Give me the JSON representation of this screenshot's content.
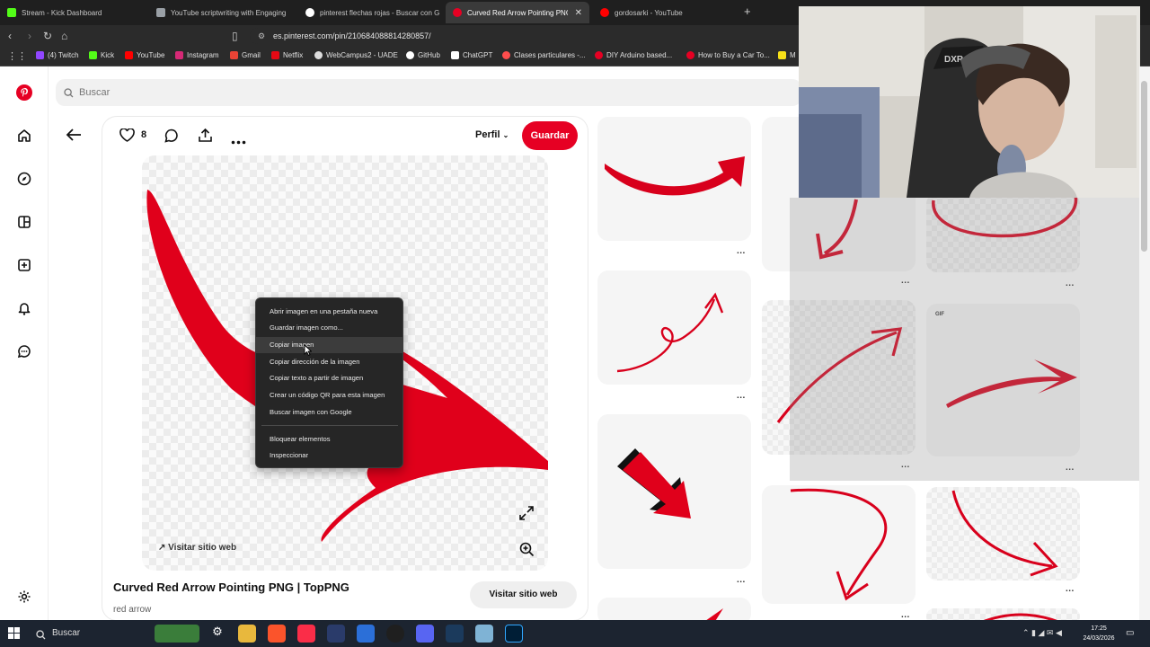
{
  "browser": {
    "tabs": [
      {
        "title": "Stream - Kick Dashboard",
        "color": "#53fc18"
      },
      {
        "title": "YouTube scriptwriting with Engaging",
        "color": "#9aa0a6"
      },
      {
        "title": "pinterest flechas rojas - Buscar con G",
        "color": "#ffffff"
      },
      {
        "title": "Curved Red Arrow Pointing PNG",
        "color": "#e60023"
      },
      {
        "title": "gordosarki - YouTube",
        "color": "#ff0000"
      }
    ],
    "new_tab": "+",
    "url": "es.pinterest.com/pin/210684088814280857/",
    "bookmarks": [
      {
        "label": "(4) Twitch",
        "color": "#9146ff"
      },
      {
        "label": "Kick",
        "color": "#53fc18"
      },
      {
        "label": "YouTube",
        "color": "#ff0000"
      },
      {
        "label": "Instagram",
        "color": "#d62976"
      },
      {
        "label": "Gmail",
        "color": "#ea4335"
      },
      {
        "label": "Netflix",
        "color": "#e50914"
      },
      {
        "label": "WebCampus2 - UADE",
        "color": "#dddddd"
      },
      {
        "label": "GitHub",
        "color": "#ffffff"
      },
      {
        "label": "ChatGPT",
        "color": "#ffffff"
      },
      {
        "label": "Clases particulares -...",
        "color": "#ff4d4d"
      },
      {
        "label": "DIY Arduino based...",
        "color": "#e60023"
      },
      {
        "label": "How to Buy a Car To...",
        "color": "#e60023"
      },
      {
        "label": "M",
        "color": "#f7e018"
      }
    ]
  },
  "search": {
    "placeholder": "Buscar"
  },
  "pin": {
    "like_count": "8",
    "profile_label": "Perfil",
    "save_label": "Guardar",
    "title": "Curved Red Arrow Pointing PNG | TopPNG",
    "subtitle": "red arrow",
    "visit_button": "Visitar sitio web",
    "visit_link": "Visitar sitio web"
  },
  "context_menu": {
    "items": [
      "Abrir imagen en una pestaña nueva",
      "Guardar imagen como...",
      "Copiar imagen",
      "Copiar dirección de la imagen",
      "Copiar texto a partir de imagen",
      "Crear un código QR para esta imagen",
      "Buscar imagen con Google"
    ],
    "items2": [
      "Bloquear elementos",
      "Inspeccionar"
    ]
  },
  "grid": {
    "gif_badge": "GIF",
    "more": "..."
  },
  "taskbar": {
    "search": "Buscar",
    "time": "17:25",
    "date": "24/03/2026"
  },
  "colors": {
    "brand": "#e60023",
    "arrow": "#e0001b"
  }
}
